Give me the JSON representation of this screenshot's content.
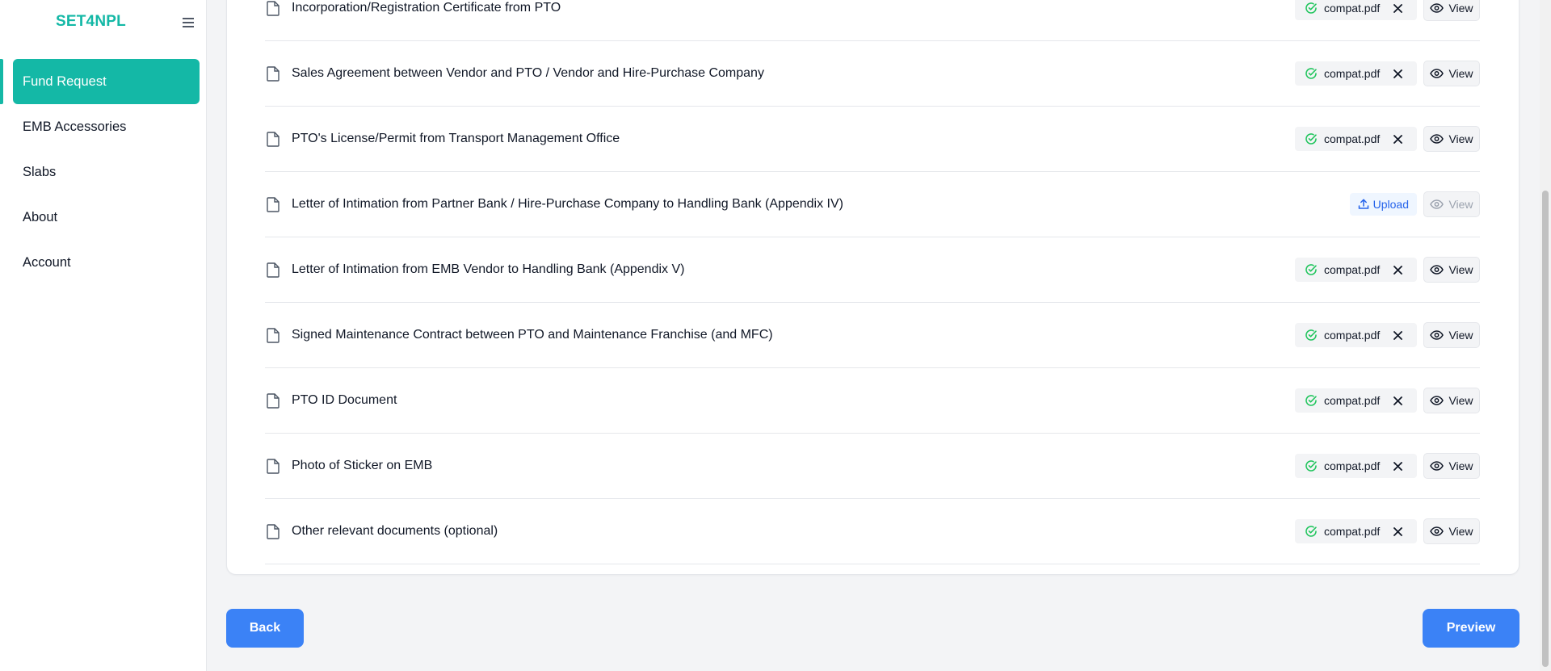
{
  "app": {
    "brand": "SET4NPL"
  },
  "sidebar": {
    "items": [
      {
        "label": "Fund Request",
        "active": true
      },
      {
        "label": "EMB Accessories",
        "active": false
      },
      {
        "label": "Slabs",
        "active": false
      },
      {
        "label": "About",
        "active": false
      },
      {
        "label": "Account",
        "active": false
      }
    ]
  },
  "documents": [
    {
      "title": "Incorporation/Registration Certificate from PTO",
      "status": "uploaded",
      "file": "compat.pdf",
      "view_label": "View"
    },
    {
      "title": "Sales Agreement between Vendor and PTO / Vendor and Hire-Purchase Company",
      "status": "uploaded",
      "file": "compat.pdf",
      "view_label": "View"
    },
    {
      "title": "PTO's License/Permit from Transport Management Office",
      "status": "uploaded",
      "file": "compat.pdf",
      "view_label": "View"
    },
    {
      "title": "Letter of Intimation from Partner Bank / Hire-Purchase Company to Handling Bank (Appendix IV)",
      "status": "pending",
      "upload_label": "Upload",
      "view_label": "View"
    },
    {
      "title": "Letter of Intimation from EMB Vendor to Handling Bank (Appendix V)",
      "status": "uploaded",
      "file": "compat.pdf",
      "view_label": "View"
    },
    {
      "title": "Signed Maintenance Contract between PTO and Maintenance Franchise (and MFC)",
      "status": "uploaded",
      "file": "compat.pdf",
      "view_label": "View"
    },
    {
      "title": "PTO ID Document",
      "status": "uploaded",
      "file": "compat.pdf",
      "view_label": "View"
    },
    {
      "title": "Photo of Sticker on EMB",
      "status": "uploaded",
      "file": "compat.pdf",
      "view_label": "View"
    },
    {
      "title": "Other relevant documents (optional)",
      "status": "uploaded",
      "file": "compat.pdf",
      "view_label": "View"
    }
  ],
  "footer": {
    "back_label": "Back",
    "preview_label": "Preview"
  },
  "colors": {
    "brand": "#14b8a6",
    "primary": "#3b82f6",
    "success": "#22c55e",
    "upload": "#2563eb",
    "background": "#f3f4f6"
  },
  "icons": {
    "doc": "file-icon",
    "uploaded": "check-circle-icon",
    "remove": "close-icon",
    "view": "eye-icon",
    "upload": "upload-icon",
    "menu": "hamburger-menu-icon"
  }
}
